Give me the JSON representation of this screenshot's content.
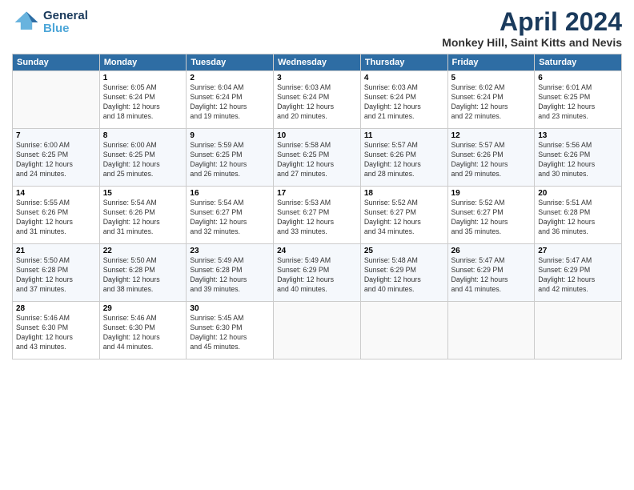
{
  "header": {
    "logo_general": "General",
    "logo_blue": "Blue",
    "month": "April 2024",
    "location": "Monkey Hill, Saint Kitts and Nevis"
  },
  "weekdays": [
    "Sunday",
    "Monday",
    "Tuesday",
    "Wednesday",
    "Thursday",
    "Friday",
    "Saturday"
  ],
  "weeks": [
    [
      {
        "day": "",
        "info": ""
      },
      {
        "day": "1",
        "info": "Sunrise: 6:05 AM\nSunset: 6:24 PM\nDaylight: 12 hours\nand 18 minutes."
      },
      {
        "day": "2",
        "info": "Sunrise: 6:04 AM\nSunset: 6:24 PM\nDaylight: 12 hours\nand 19 minutes."
      },
      {
        "day": "3",
        "info": "Sunrise: 6:03 AM\nSunset: 6:24 PM\nDaylight: 12 hours\nand 20 minutes."
      },
      {
        "day": "4",
        "info": "Sunrise: 6:03 AM\nSunset: 6:24 PM\nDaylight: 12 hours\nand 21 minutes."
      },
      {
        "day": "5",
        "info": "Sunrise: 6:02 AM\nSunset: 6:24 PM\nDaylight: 12 hours\nand 22 minutes."
      },
      {
        "day": "6",
        "info": "Sunrise: 6:01 AM\nSunset: 6:25 PM\nDaylight: 12 hours\nand 23 minutes."
      }
    ],
    [
      {
        "day": "7",
        "info": "Sunrise: 6:00 AM\nSunset: 6:25 PM\nDaylight: 12 hours\nand 24 minutes."
      },
      {
        "day": "8",
        "info": "Sunrise: 6:00 AM\nSunset: 6:25 PM\nDaylight: 12 hours\nand 25 minutes."
      },
      {
        "day": "9",
        "info": "Sunrise: 5:59 AM\nSunset: 6:25 PM\nDaylight: 12 hours\nand 26 minutes."
      },
      {
        "day": "10",
        "info": "Sunrise: 5:58 AM\nSunset: 6:25 PM\nDaylight: 12 hours\nand 27 minutes."
      },
      {
        "day": "11",
        "info": "Sunrise: 5:57 AM\nSunset: 6:26 PM\nDaylight: 12 hours\nand 28 minutes."
      },
      {
        "day": "12",
        "info": "Sunrise: 5:57 AM\nSunset: 6:26 PM\nDaylight: 12 hours\nand 29 minutes."
      },
      {
        "day": "13",
        "info": "Sunrise: 5:56 AM\nSunset: 6:26 PM\nDaylight: 12 hours\nand 30 minutes."
      }
    ],
    [
      {
        "day": "14",
        "info": "Sunrise: 5:55 AM\nSunset: 6:26 PM\nDaylight: 12 hours\nand 31 minutes."
      },
      {
        "day": "15",
        "info": "Sunrise: 5:54 AM\nSunset: 6:26 PM\nDaylight: 12 hours\nand 31 minutes."
      },
      {
        "day": "16",
        "info": "Sunrise: 5:54 AM\nSunset: 6:27 PM\nDaylight: 12 hours\nand 32 minutes."
      },
      {
        "day": "17",
        "info": "Sunrise: 5:53 AM\nSunset: 6:27 PM\nDaylight: 12 hours\nand 33 minutes."
      },
      {
        "day": "18",
        "info": "Sunrise: 5:52 AM\nSunset: 6:27 PM\nDaylight: 12 hours\nand 34 minutes."
      },
      {
        "day": "19",
        "info": "Sunrise: 5:52 AM\nSunset: 6:27 PM\nDaylight: 12 hours\nand 35 minutes."
      },
      {
        "day": "20",
        "info": "Sunrise: 5:51 AM\nSunset: 6:28 PM\nDaylight: 12 hours\nand 36 minutes."
      }
    ],
    [
      {
        "day": "21",
        "info": "Sunrise: 5:50 AM\nSunset: 6:28 PM\nDaylight: 12 hours\nand 37 minutes."
      },
      {
        "day": "22",
        "info": "Sunrise: 5:50 AM\nSunset: 6:28 PM\nDaylight: 12 hours\nand 38 minutes."
      },
      {
        "day": "23",
        "info": "Sunrise: 5:49 AM\nSunset: 6:28 PM\nDaylight: 12 hours\nand 39 minutes."
      },
      {
        "day": "24",
        "info": "Sunrise: 5:49 AM\nSunset: 6:29 PM\nDaylight: 12 hours\nand 40 minutes."
      },
      {
        "day": "25",
        "info": "Sunrise: 5:48 AM\nSunset: 6:29 PM\nDaylight: 12 hours\nand 40 minutes."
      },
      {
        "day": "26",
        "info": "Sunrise: 5:47 AM\nSunset: 6:29 PM\nDaylight: 12 hours\nand 41 minutes."
      },
      {
        "day": "27",
        "info": "Sunrise: 5:47 AM\nSunset: 6:29 PM\nDaylight: 12 hours\nand 42 minutes."
      }
    ],
    [
      {
        "day": "28",
        "info": "Sunrise: 5:46 AM\nSunset: 6:30 PM\nDaylight: 12 hours\nand 43 minutes."
      },
      {
        "day": "29",
        "info": "Sunrise: 5:46 AM\nSunset: 6:30 PM\nDaylight: 12 hours\nand 44 minutes."
      },
      {
        "day": "30",
        "info": "Sunrise: 5:45 AM\nSunset: 6:30 PM\nDaylight: 12 hours\nand 45 minutes."
      },
      {
        "day": "",
        "info": ""
      },
      {
        "day": "",
        "info": ""
      },
      {
        "day": "",
        "info": ""
      },
      {
        "day": "",
        "info": ""
      }
    ]
  ]
}
